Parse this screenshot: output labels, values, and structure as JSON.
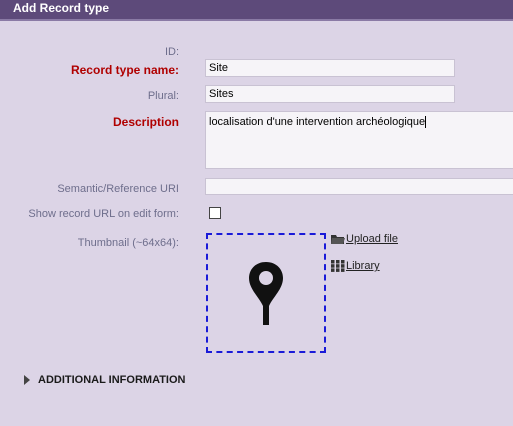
{
  "window": {
    "title": "Add Record type"
  },
  "form": {
    "id_label": "ID:",
    "id_value": "",
    "name_label": "Record type name:",
    "name_value": "Site",
    "plural_label": "Plural:",
    "plural_value": "Sites",
    "description_label": "Description",
    "description_value": "localisation d'une intervention archéologique",
    "uri_label": "Semantic/Reference URI",
    "uri_value": "",
    "show_url_label": "Show record URL on edit form:",
    "show_url_checked": false,
    "thumbnail_label": "Thumbnail (~64x64):",
    "thumbnail_icon": "map-pin-icon",
    "upload_label": "Upload file",
    "library_label": "Library"
  },
  "sections": {
    "additional_label": "ADDITIONAL INFORMATION"
  },
  "colors": {
    "titlebar": "#5d4a7a",
    "background": "#dcd4e6",
    "required_label": "#b00000",
    "thumbnail_border": "#1a1ad8"
  }
}
